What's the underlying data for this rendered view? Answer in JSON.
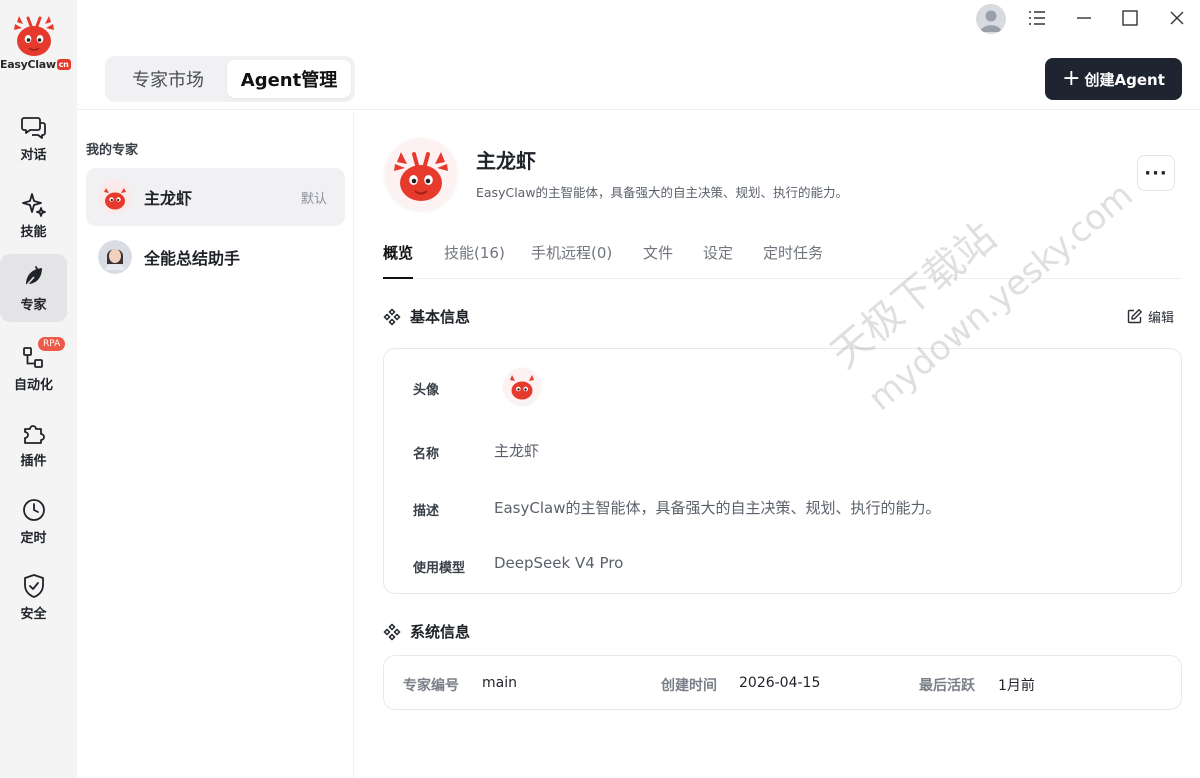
{
  "brand": {
    "name": "EasyClaw",
    "suffix": "cn"
  },
  "nav": {
    "items": [
      {
        "id": "chat",
        "label": "对话",
        "icon": "chat-icon"
      },
      {
        "id": "skills",
        "label": "技能",
        "icon": "sparkle-icon"
      },
      {
        "id": "experts",
        "label": "专家",
        "icon": "leaf-icon",
        "active": true
      },
      {
        "id": "automation",
        "label": "自动化",
        "icon": "flow-icon",
        "badge": "RPA"
      },
      {
        "id": "plugins",
        "label": "插件",
        "icon": "puzzle-icon"
      },
      {
        "id": "schedule",
        "label": "定时",
        "icon": "clock-icon"
      },
      {
        "id": "security",
        "label": "安全",
        "icon": "shield-icon"
      }
    ]
  },
  "header": {
    "tabs": [
      {
        "label": "专家市场"
      },
      {
        "label": "Agent管理",
        "active": true
      }
    ],
    "create_button": "创建Agent"
  },
  "experts": {
    "title": "我的专家",
    "items": [
      {
        "name": "主龙虾",
        "tag": "默认",
        "active": true
      },
      {
        "name": "全能总结助手"
      }
    ]
  },
  "detail": {
    "name": "主龙虾",
    "description": "EasyClaw的主智能体，具备强大的自主决策、规划、执行的能力。",
    "more_label": "···",
    "tabs": [
      {
        "label": "概览",
        "active": true
      },
      {
        "label": "技能(16)"
      },
      {
        "label": "手机远程(0)"
      },
      {
        "label": "文件"
      },
      {
        "label": "设定"
      },
      {
        "label": "定时任务"
      }
    ],
    "basic": {
      "title": "基本信息",
      "edit_label": "编辑",
      "avatar_label": "头像",
      "name_label": "名称",
      "name_value": "主龙虾",
      "desc_label": "描述",
      "desc_value": "EasyClaw的主智能体，具备强大的自主决策、规划、执行的能力。",
      "model_label": "使用模型",
      "model_value": "DeepSeek V4 Pro"
    },
    "system": {
      "title": "系统信息",
      "id_label": "专家编号",
      "id_value": "main",
      "created_label": "创建时间",
      "created_value": "2026-04-15",
      "active_label": "最后活跃",
      "active_value": "1月前"
    }
  },
  "watermark": {
    "line1": "天极下载站",
    "line2": "mydown.yesky.com"
  },
  "colors": {
    "accent_dark": "#1e2430",
    "brand_red": "#e63a2c",
    "badge": "#ee5a4a"
  }
}
